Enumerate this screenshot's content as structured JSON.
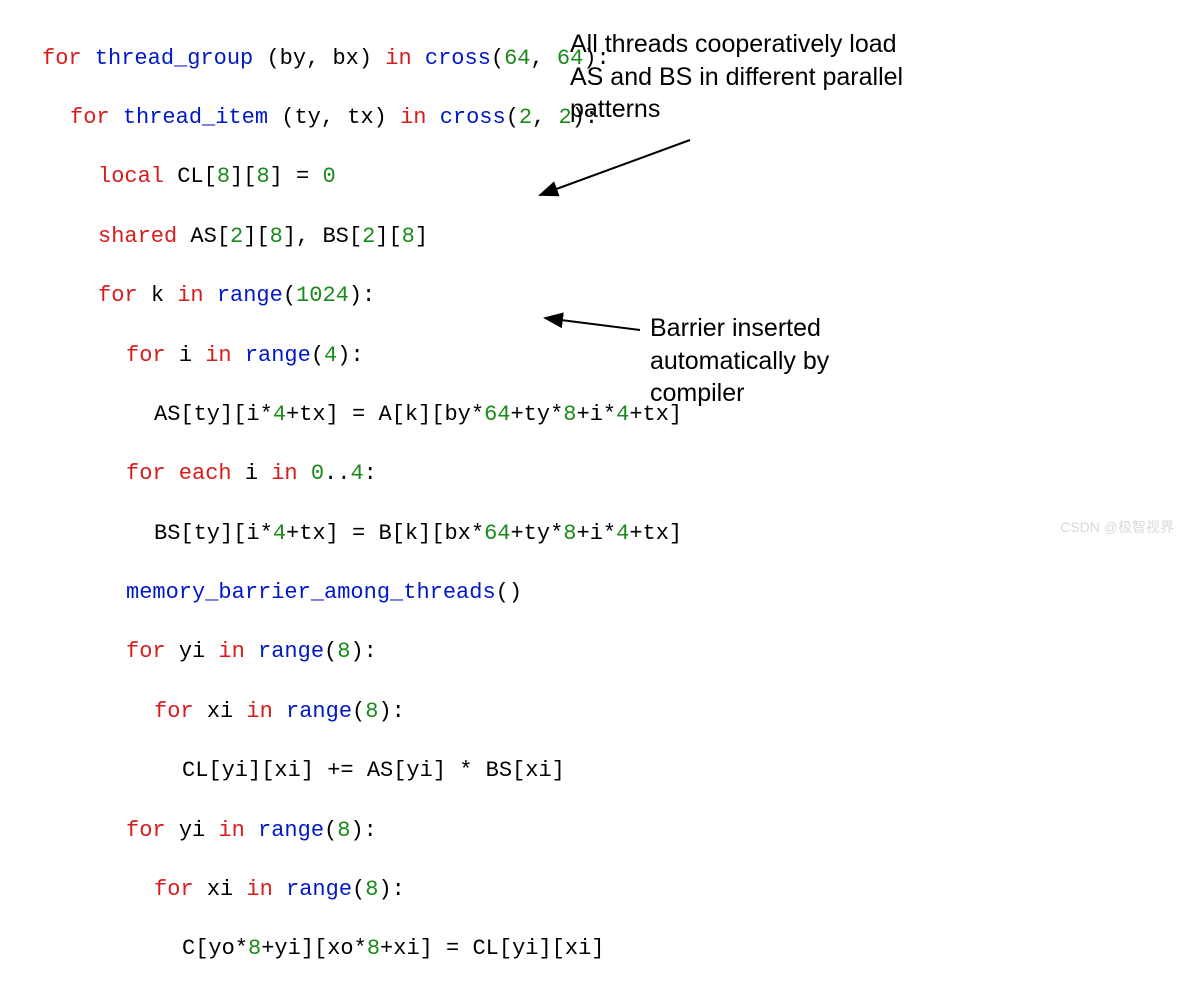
{
  "code": {
    "l1": {
      "kw1": "for",
      "id1": "thread_group",
      "paren": " (",
      "v1": "by",
      "c1": ", ",
      "v2": "bx",
      "paren2": ") ",
      "kw2": "in",
      "sp": " ",
      "fn": "cross",
      "op": "(",
      "n1": "64",
      "c2": ", ",
      "n2": "64",
      "cl": "):"
    },
    "l2": {
      "kw1": "for",
      "id1": "thread_item",
      "paren": " (",
      "v1": "ty",
      "c1": ", ",
      "v2": "tx",
      "paren2": ") ",
      "kw2": "in",
      "sp": " ",
      "fn": "cross",
      "op": "(",
      "n1": "2",
      "c2": ", ",
      "n2": "2",
      "cl": "):"
    },
    "l3": {
      "kw": "local",
      "sp": " ",
      "id": "CL",
      "b1": "[",
      "n1": "8",
      "b2": "][",
      "n2": "8",
      "b3": "] = ",
      "n3": "0"
    },
    "l4": {
      "kw": "shared",
      "sp": " ",
      "id1": "AS",
      "b1": "[",
      "n1": "2",
      "b2": "][",
      "n2": "8",
      "b3": "], ",
      "id2": "BS",
      "b4": "[",
      "n3": "2",
      "b5": "][",
      "n4": "8",
      "b6": "]"
    },
    "l5": {
      "kw1": "for",
      "sp": " ",
      "v": "k",
      "sp2": " ",
      "kw2": "in",
      "sp3": " ",
      "fn": "range",
      "op": "(",
      "n": "1024",
      "cl": "):"
    },
    "l6": {
      "kw1": "for",
      "sp": " ",
      "v": "i",
      "sp2": " ",
      "kw2": "in",
      "sp3": " ",
      "fn": "range",
      "op": "(",
      "n": "4",
      "cl": "):"
    },
    "l7": {
      "lhs": "AS[ty][i*",
      "n1": "4",
      "mid": "+tx] = A[k][by*",
      "n2": "64",
      "mid2": "+ty*",
      "n3": "8",
      "mid3": "+i*",
      "n4": "4",
      "end": "+tx]"
    },
    "l8": {
      "kw1": "for each",
      "sp": " ",
      "v": "i",
      "sp2": " ",
      "kw2": "in",
      "sp3": " ",
      "n1": "0",
      "dd": "..",
      "n2": "4",
      "cl": ":"
    },
    "l9": {
      "lhs": "BS[ty][i*",
      "n1": "4",
      "mid": "+tx] = B[k][bx*",
      "n2": "64",
      "mid2": "+ty*",
      "n3": "8",
      "mid3": "+i*",
      "n4": "4",
      "end": "+tx]"
    },
    "l10": {
      "fn": "memory_barrier_among_threads",
      "par": "()"
    },
    "l11": {
      "kw1": "for",
      "sp": " ",
      "v": "yi",
      "sp2": " ",
      "kw2": "in",
      "sp3": " ",
      "fn": "range",
      "op": "(",
      "n": "8",
      "cl": "):"
    },
    "l12": {
      "kw1": "for",
      "sp": " ",
      "v": "xi",
      "sp2": " ",
      "kw2": "in",
      "sp3": " ",
      "fn": "range",
      "op": "(",
      "n": "8",
      "cl": "):"
    },
    "l13": {
      "body": "CL[yi][xi] += AS[yi] * BS[xi]"
    },
    "l14": {
      "kw1": "for",
      "sp": " ",
      "v": "yi",
      "sp2": " ",
      "kw2": "in",
      "sp3": " ",
      "fn": "range",
      "op": "(",
      "n": "8",
      "cl": "):"
    },
    "l15": {
      "kw1": "for",
      "sp": " ",
      "v": "xi",
      "sp2": " ",
      "kw2": "in",
      "sp3": " ",
      "fn": "range",
      "op": "(",
      "n": "8",
      "cl": "):"
    },
    "l16": {
      "lhs": "C[yo*",
      "n1": "8",
      "mid": "+yi][xo*",
      "n2": "8",
      "end": "+xi] = CL[yi][xi]"
    }
  },
  "annotations": {
    "a1": "All threads cooperatively load AS and BS in different parallel patterns",
    "a2": "Barrier inserted automatically by compiler"
  },
  "watermark": "CSDN @极智视界"
}
